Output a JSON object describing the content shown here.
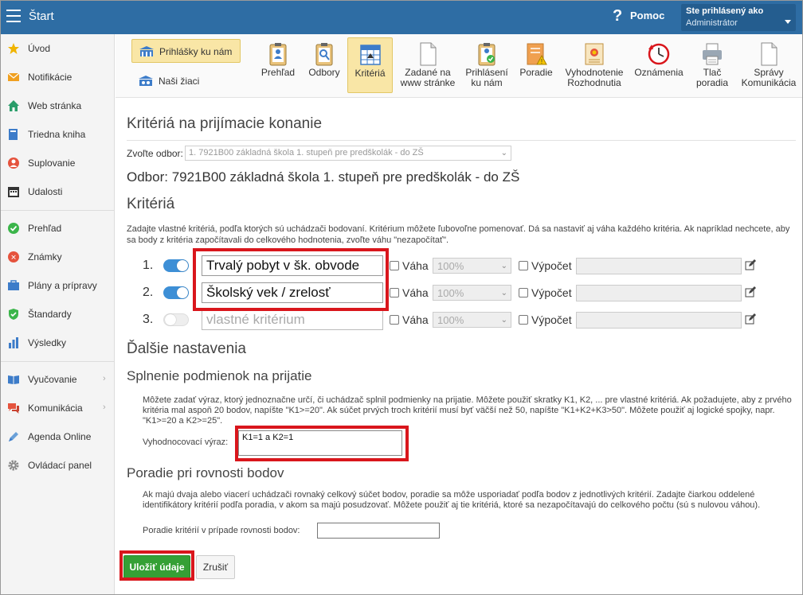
{
  "header": {
    "app_title": "Štart",
    "help_icon_glyph": "?",
    "help_label": "Pomoc",
    "user_line1": "Ste prihlásený ako",
    "user_line2": "Administrátor",
    "color": "#2e6da4"
  },
  "sidebar": {
    "items": [
      {
        "label": "Úvod",
        "icon": "star-icon"
      },
      {
        "label": "Notifikácie",
        "icon": "envelope-icon"
      },
      {
        "label": "Web stránka",
        "icon": "home-icon"
      },
      {
        "label": "Triedna kniha",
        "icon": "book-icon"
      },
      {
        "label": "Suplovanie",
        "icon": "person-icon"
      },
      {
        "label": "Udalosti",
        "icon": "calendar-icon"
      },
      {
        "label": "Prehľad",
        "icon": "check-circle-icon"
      },
      {
        "label": "Známky",
        "icon": "grade-icon"
      },
      {
        "label": "Plány a prípravy",
        "icon": "briefcase-icon"
      },
      {
        "label": "Štandardy",
        "icon": "shield-check-icon"
      },
      {
        "label": "Výsledky",
        "icon": "bar-chart-icon"
      },
      {
        "label": "Vyučovanie",
        "icon": "open-book-icon"
      },
      {
        "label": "Komunikácia",
        "icon": "chat-icon"
      },
      {
        "label": "Agenda Online",
        "icon": "pen-icon"
      },
      {
        "label": "Ovládací panel",
        "icon": "gear-icon"
      }
    ]
  },
  "toolbar": {
    "group_buttons": [
      {
        "label": "Prihlášky ku nám",
        "active": true
      },
      {
        "label": "Naši žiaci",
        "active": false
      }
    ],
    "tools": [
      {
        "label1": "Prehľad",
        "label2": "",
        "active": false
      },
      {
        "label1": "Odbory",
        "label2": "",
        "active": false
      },
      {
        "label1": "Kritériá",
        "label2": "",
        "active": true
      },
      {
        "label1": "Zadané na",
        "label2": "www stránke",
        "active": false
      },
      {
        "label1": "Prihlásení",
        "label2": "ku nám",
        "active": false
      },
      {
        "label1": "Poradie",
        "label2": "",
        "active": false
      },
      {
        "label1": "Vyhodnotenie",
        "label2": "Rozhodnutia",
        "active": false
      },
      {
        "label1": "Oznámenia",
        "label2": "",
        "active": false
      },
      {
        "label1": "Tlač",
        "label2": "poradia",
        "active": false
      },
      {
        "label1": "Správy",
        "label2": "Komunikácia",
        "active": false
      }
    ]
  },
  "main": {
    "title": "Kritériá na prijímacie konanie",
    "odbor_label": "Zvoľte odbor:",
    "odbor_select_value": "1. 7921B00 základná škola 1. stupeň pre predškolák - do ZŠ",
    "odbor_heading": "Odbor: 7921B00 základná škola 1. stupeň pre predškolák - do ZŠ",
    "kriteria_heading": "Kritériá",
    "kriteria_desc": "Zadajte vlastné kritériá, podľa ktorých sú uchádzači bodovaní. Kritérium môžete ľubovoľne pomenovať. Dá sa nastaviť aj váha každého kritéria. Ak napríklad nechcete, aby sa body z kritéria započítavali do celkového hodnotenia, zvoľte váhu \"nezapočítať\".",
    "vaha_label": "Váha",
    "vypocet_label": "Výpočet",
    "criteria": [
      {
        "num": "1.",
        "on": true,
        "value": "Trvalý pobyt v šk. obvode",
        "placeholder": "",
        "weight": "100%"
      },
      {
        "num": "2.",
        "on": true,
        "value": "Školský vek / zrelosť",
        "placeholder": "",
        "weight": "100%"
      },
      {
        "num": "3.",
        "on": false,
        "value": "",
        "placeholder": "vlastné kritérium",
        "weight": "100%"
      }
    ],
    "dalsie_heading": "Ďalšie nastavenia",
    "splnenie_heading": "Splnenie podmienok na prijatie",
    "splnenie_desc": "Môžete zadať výraz, ktorý jednoznačne určí, či uchádzač splnil podmienky na prijatie. Môžete použiť skratky K1, K2, ... pre vlastné kritériá. Ak požadujete, aby z prvého kritéria mal aspoň 20 bodov, napíšte \"K1>=20\". Ak súčet prvých troch kritérií musí byť väčší než 50, napíšte \"K1+K2+K3>50\". Môžete použiť aj logické spojky, napr. \"K1>=20 a K2>=25\".",
    "vyhod_label": "Vyhodnocovací výraz:",
    "vyhod_value": "K1=1 a K2=1",
    "poradie_heading": "Poradie pri rovnosti bodov",
    "poradie_desc": "Ak majú dvaja alebo viacerí uchádzači rovnaký celkový súčet bodov, poradie sa môže usporiadať podľa bodov z jednotlivých kritérií. Zadajte čiarkou oddelené identifikátory kritérií podľa poradia, v akom sa majú posudzovať. Môžete použiť aj tie kritériá, ktoré sa nezapočítavajú do celkového počtu (sú s nulovou váhou).",
    "poradie_label": "Poradie kritérií v prípade rovnosti bodov:",
    "poradie_value": "",
    "save_label": "Uložiť údaje",
    "cancel_label": "Zrušiť"
  },
  "colors": {
    "header": "#2e6da4",
    "highlight": "#d9161c",
    "save_button": "#35a035",
    "active_tool": "#f9e6a6",
    "toggle_on": "#3d8fd6"
  }
}
